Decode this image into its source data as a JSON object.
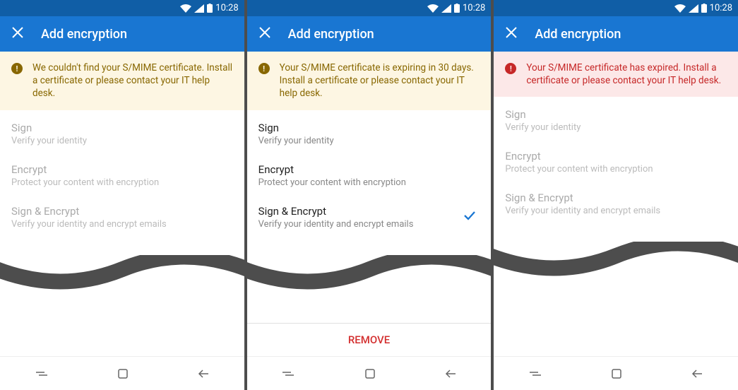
{
  "status": {
    "time": "10:28"
  },
  "appbar": {
    "title": "Add encryption"
  },
  "banners": {
    "notfound": "We couldn't find your S/MIME certificate. Install a certificate or please contact your IT help desk.",
    "expiring": "Your S/MIME certificate is expiring in 30 days. Install a certificate or please contact your IT help desk.",
    "expired": "Your S/MIME certificate has expired. Install a certificate or please contact your IT help desk."
  },
  "options": {
    "sign": {
      "title": "Sign",
      "sub": "Verify your identity"
    },
    "encrypt": {
      "title": "Encrypt",
      "sub": "Protect your content with encryption"
    },
    "both": {
      "title": "Sign & Encrypt",
      "sub": "Verify your identity and encrypt emails"
    }
  },
  "actions": {
    "remove": "REMOVE"
  }
}
